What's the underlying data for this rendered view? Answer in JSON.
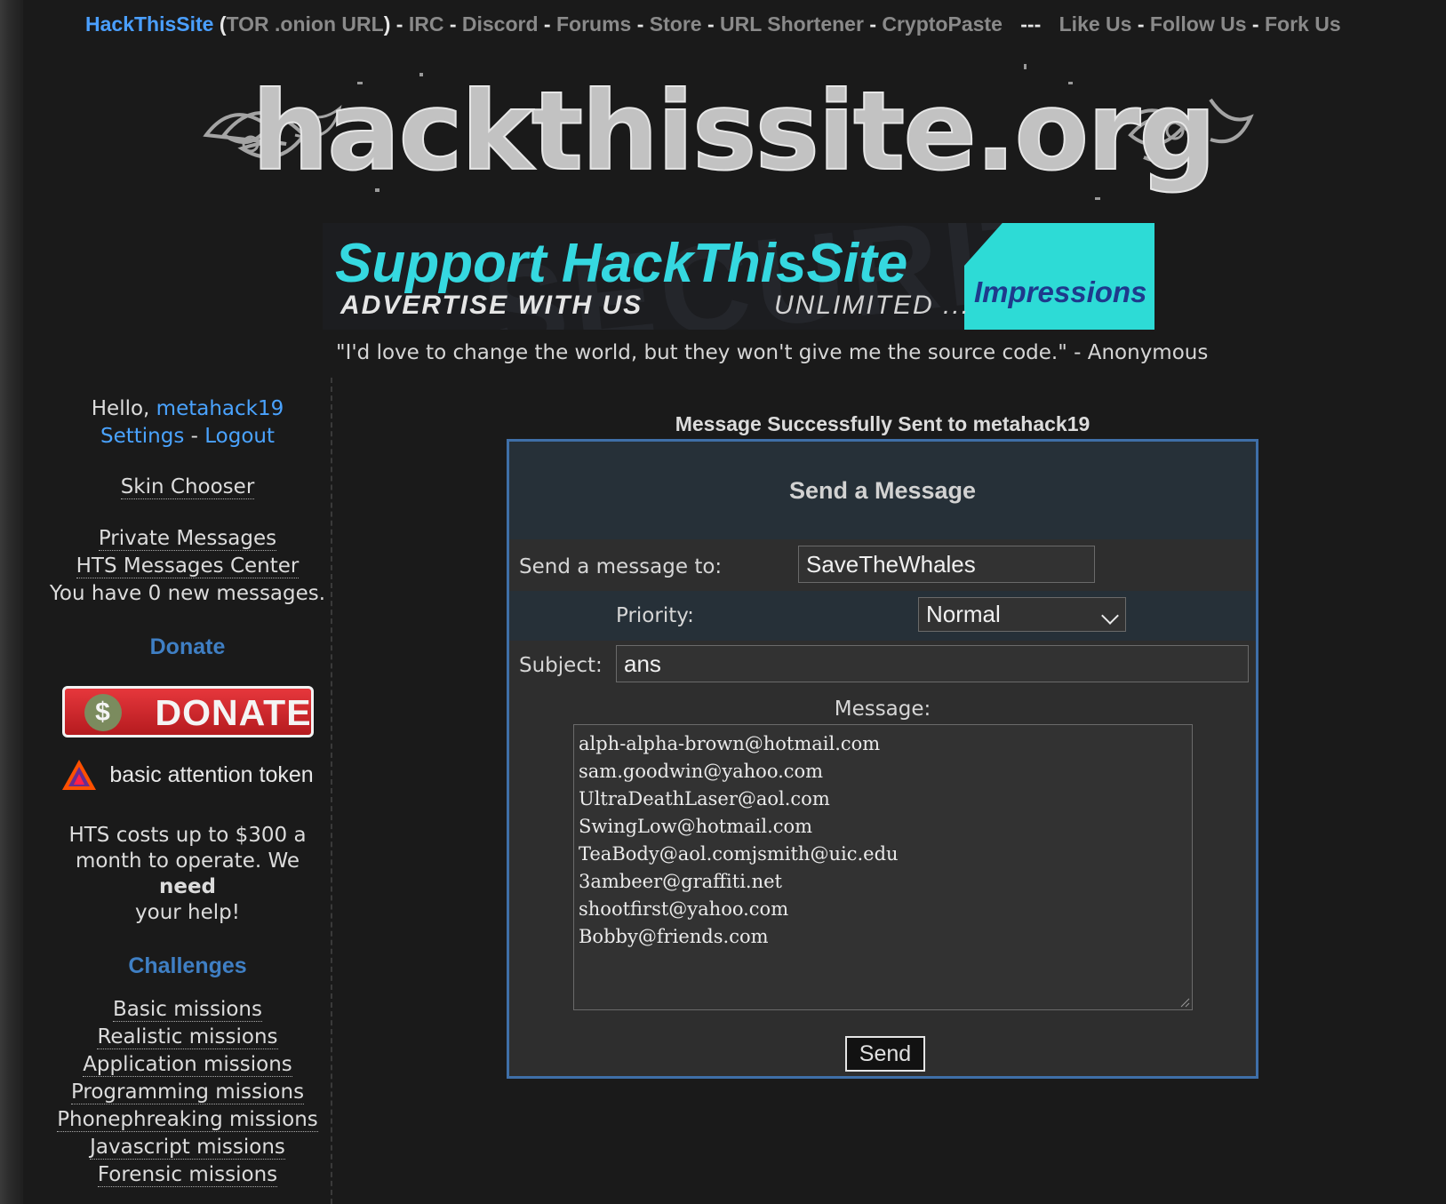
{
  "topnav": {
    "brand": "HackThisSite",
    "tor_link": "TOR .onion URL",
    "links": [
      "IRC",
      "Discord",
      "Forums",
      "Store",
      "URL Shortener",
      "CryptoPaste"
    ],
    "divider": "---",
    "social": [
      "Like Us",
      "Follow Us",
      "Fork Us"
    ]
  },
  "logo": {
    "text": "hackthissite.org"
  },
  "banner": {
    "main": "Support HackThisSite",
    "advertise": "ADVERTISE WITH US",
    "unlimited": "UNLIMITED ...",
    "impressions": "Impressions",
    "ghost": "SECURITY"
  },
  "quote": "\"I'd love to change the world, but they won't give me the source code.\" - Anonymous",
  "sidebar": {
    "greeting": "Hello,",
    "username": "metahack19",
    "settings": "Settings",
    "logout": "Logout",
    "skin_chooser": "Skin Chooser",
    "private_messages": "Private Messages",
    "hts_messages_center": "HTS Messages Center",
    "new_messages": "You have 0 new messages.",
    "donate_heading": "Donate",
    "donate_button": "DONATE",
    "donate_coin": "$",
    "bat_label": "basic attention token",
    "costs_text_1": "HTS costs up to $300 a",
    "costs_text_2": "month to operate. We",
    "costs_need": "need",
    "costs_text_3": "your help!",
    "challenges_heading": "Challenges",
    "challenges": [
      "Basic missions",
      "Realistic missions",
      "Application missions",
      "Programming missions",
      "Phonephreaking missions",
      "Javascript missions",
      "Forensic missions"
    ]
  },
  "main": {
    "success": "Message Successfully Sent to metahack19",
    "panel_title": "Send a Message",
    "to_label": "Send a message to:",
    "to_value": "SaveTheWhales",
    "priority_label": "Priority:",
    "priority_value": "Normal",
    "subject_label": "Subject:",
    "subject_value": "ans",
    "message_label": "Message:",
    "message_lines": [
      "alph-alpha-brown@hotmail.com",
      "sam.goodwin@yahoo.com",
      "UltraDeathLaser@aol.com",
      "SwingLow@hotmail.com",
      "TeaBody@aol.comjsmith@uic.edu",
      "3ambeer@graffiti.net",
      "shootfirst@yahoo.com",
      "Bobby@friends.com"
    ],
    "send_button": "Send"
  },
  "colors": {
    "background": "#1a1a1a",
    "brand_blue": "#4a9fff",
    "heading_blue": "#3f7fc4",
    "panel_border": "#3f6fa8",
    "banner_cyan": "#2ddbd6"
  }
}
